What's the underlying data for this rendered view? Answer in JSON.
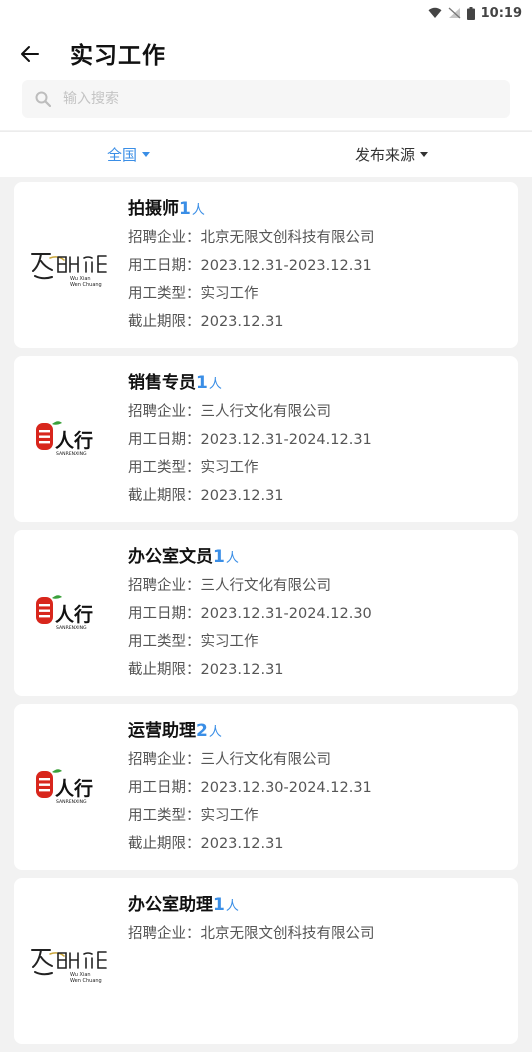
{
  "status_bar": {
    "time": "10:19"
  },
  "header": {
    "title": "实习工作"
  },
  "search": {
    "placeholder": "输入搜索",
    "value": ""
  },
  "filters": [
    {
      "label": "全国",
      "active": true
    },
    {
      "label": "发布来源",
      "active": false
    }
  ],
  "labels": {
    "company": "招聘企业：",
    "dates": "用工日期：",
    "type": "用工类型：",
    "deadline": "截止期限："
  },
  "jobs": [
    {
      "title": "拍摄师",
      "count": "1",
      "unit": "人",
      "company": "北京无限文创科技有限公司",
      "dates": "2023.12.31-2023.12.31",
      "type": "实习工作",
      "deadline": "2023.12.31",
      "logo": "wuxian-wenchuang",
      "logo_lines": [
        "Wu Xian",
        "Wen Chuang"
      ]
    },
    {
      "title": "销售专员",
      "count": "1",
      "unit": "人",
      "company": "三人行文化有限公司",
      "dates": "2023.12.31-2024.12.31",
      "type": "实习工作",
      "deadline": "2023.12.31",
      "logo": "sanrenxing",
      "logo_text": "人行",
      "logo_sub": "SANRENXING"
    },
    {
      "title": "办公室文员",
      "count": "1",
      "unit": "人",
      "company": "三人行文化有限公司",
      "dates": "2023.12.31-2024.12.30",
      "type": "实习工作",
      "deadline": "2023.12.31",
      "logo": "sanrenxing",
      "logo_text": "人行",
      "logo_sub": "SANRENXING"
    },
    {
      "title": "运营助理",
      "count": "2",
      "unit": "人",
      "company": "三人行文化有限公司",
      "dates": "2023.12.30-2024.12.31",
      "type": "实习工作",
      "deadline": "2023.12.31",
      "logo": "sanrenxing",
      "logo_text": "人行",
      "logo_sub": "SANRENXING"
    },
    {
      "title": "办公室助理",
      "count": "1",
      "unit": "人",
      "company": "北京无限文创科技有限公司",
      "dates": "",
      "type": "",
      "deadline": "",
      "logo": "wuxian-wenchuang",
      "logo_lines": [
        "Wu Xian",
        "Wen Chuang"
      ]
    }
  ]
}
